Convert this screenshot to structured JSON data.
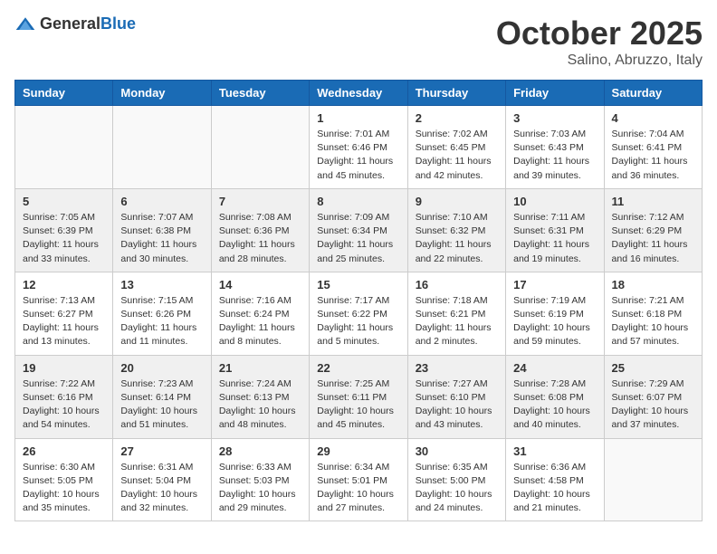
{
  "header": {
    "logo_general": "General",
    "logo_blue": "Blue",
    "month": "October 2025",
    "location": "Salino, Abruzzo, Italy"
  },
  "weekdays": [
    "Sunday",
    "Monday",
    "Tuesday",
    "Wednesday",
    "Thursday",
    "Friday",
    "Saturday"
  ],
  "weeks": [
    [
      {
        "day": "",
        "sunrise": "",
        "sunset": "",
        "daylight": ""
      },
      {
        "day": "",
        "sunrise": "",
        "sunset": "",
        "daylight": ""
      },
      {
        "day": "",
        "sunrise": "",
        "sunset": "",
        "daylight": ""
      },
      {
        "day": "1",
        "sunrise": "Sunrise: 7:01 AM",
        "sunset": "Sunset: 6:46 PM",
        "daylight": "Daylight: 11 hours and 45 minutes."
      },
      {
        "day": "2",
        "sunrise": "Sunrise: 7:02 AM",
        "sunset": "Sunset: 6:45 PM",
        "daylight": "Daylight: 11 hours and 42 minutes."
      },
      {
        "day": "3",
        "sunrise": "Sunrise: 7:03 AM",
        "sunset": "Sunset: 6:43 PM",
        "daylight": "Daylight: 11 hours and 39 minutes."
      },
      {
        "day": "4",
        "sunrise": "Sunrise: 7:04 AM",
        "sunset": "Sunset: 6:41 PM",
        "daylight": "Daylight: 11 hours and 36 minutes."
      }
    ],
    [
      {
        "day": "5",
        "sunrise": "Sunrise: 7:05 AM",
        "sunset": "Sunset: 6:39 PM",
        "daylight": "Daylight: 11 hours and 33 minutes."
      },
      {
        "day": "6",
        "sunrise": "Sunrise: 7:07 AM",
        "sunset": "Sunset: 6:38 PM",
        "daylight": "Daylight: 11 hours and 30 minutes."
      },
      {
        "day": "7",
        "sunrise": "Sunrise: 7:08 AM",
        "sunset": "Sunset: 6:36 PM",
        "daylight": "Daylight: 11 hours and 28 minutes."
      },
      {
        "day": "8",
        "sunrise": "Sunrise: 7:09 AM",
        "sunset": "Sunset: 6:34 PM",
        "daylight": "Daylight: 11 hours and 25 minutes."
      },
      {
        "day": "9",
        "sunrise": "Sunrise: 7:10 AM",
        "sunset": "Sunset: 6:32 PM",
        "daylight": "Daylight: 11 hours and 22 minutes."
      },
      {
        "day": "10",
        "sunrise": "Sunrise: 7:11 AM",
        "sunset": "Sunset: 6:31 PM",
        "daylight": "Daylight: 11 hours and 19 minutes."
      },
      {
        "day": "11",
        "sunrise": "Sunrise: 7:12 AM",
        "sunset": "Sunset: 6:29 PM",
        "daylight": "Daylight: 11 hours and 16 minutes."
      }
    ],
    [
      {
        "day": "12",
        "sunrise": "Sunrise: 7:13 AM",
        "sunset": "Sunset: 6:27 PM",
        "daylight": "Daylight: 11 hours and 13 minutes."
      },
      {
        "day": "13",
        "sunrise": "Sunrise: 7:15 AM",
        "sunset": "Sunset: 6:26 PM",
        "daylight": "Daylight: 11 hours and 11 minutes."
      },
      {
        "day": "14",
        "sunrise": "Sunrise: 7:16 AM",
        "sunset": "Sunset: 6:24 PM",
        "daylight": "Daylight: 11 hours and 8 minutes."
      },
      {
        "day": "15",
        "sunrise": "Sunrise: 7:17 AM",
        "sunset": "Sunset: 6:22 PM",
        "daylight": "Daylight: 11 hours and 5 minutes."
      },
      {
        "day": "16",
        "sunrise": "Sunrise: 7:18 AM",
        "sunset": "Sunset: 6:21 PM",
        "daylight": "Daylight: 11 hours and 2 minutes."
      },
      {
        "day": "17",
        "sunrise": "Sunrise: 7:19 AM",
        "sunset": "Sunset: 6:19 PM",
        "daylight": "Daylight: 10 hours and 59 minutes."
      },
      {
        "day": "18",
        "sunrise": "Sunrise: 7:21 AM",
        "sunset": "Sunset: 6:18 PM",
        "daylight": "Daylight: 10 hours and 57 minutes."
      }
    ],
    [
      {
        "day": "19",
        "sunrise": "Sunrise: 7:22 AM",
        "sunset": "Sunset: 6:16 PM",
        "daylight": "Daylight: 10 hours and 54 minutes."
      },
      {
        "day": "20",
        "sunrise": "Sunrise: 7:23 AM",
        "sunset": "Sunset: 6:14 PM",
        "daylight": "Daylight: 10 hours and 51 minutes."
      },
      {
        "day": "21",
        "sunrise": "Sunrise: 7:24 AM",
        "sunset": "Sunset: 6:13 PM",
        "daylight": "Daylight: 10 hours and 48 minutes."
      },
      {
        "day": "22",
        "sunrise": "Sunrise: 7:25 AM",
        "sunset": "Sunset: 6:11 PM",
        "daylight": "Daylight: 10 hours and 45 minutes."
      },
      {
        "day": "23",
        "sunrise": "Sunrise: 7:27 AM",
        "sunset": "Sunset: 6:10 PM",
        "daylight": "Daylight: 10 hours and 43 minutes."
      },
      {
        "day": "24",
        "sunrise": "Sunrise: 7:28 AM",
        "sunset": "Sunset: 6:08 PM",
        "daylight": "Daylight: 10 hours and 40 minutes."
      },
      {
        "day": "25",
        "sunrise": "Sunrise: 7:29 AM",
        "sunset": "Sunset: 6:07 PM",
        "daylight": "Daylight: 10 hours and 37 minutes."
      }
    ],
    [
      {
        "day": "26",
        "sunrise": "Sunrise: 6:30 AM",
        "sunset": "Sunset: 5:05 PM",
        "daylight": "Daylight: 10 hours and 35 minutes."
      },
      {
        "day": "27",
        "sunrise": "Sunrise: 6:31 AM",
        "sunset": "Sunset: 5:04 PM",
        "daylight": "Daylight: 10 hours and 32 minutes."
      },
      {
        "day": "28",
        "sunrise": "Sunrise: 6:33 AM",
        "sunset": "Sunset: 5:03 PM",
        "daylight": "Daylight: 10 hours and 29 minutes."
      },
      {
        "day": "29",
        "sunrise": "Sunrise: 6:34 AM",
        "sunset": "Sunset: 5:01 PM",
        "daylight": "Daylight: 10 hours and 27 minutes."
      },
      {
        "day": "30",
        "sunrise": "Sunrise: 6:35 AM",
        "sunset": "Sunset: 5:00 PM",
        "daylight": "Daylight: 10 hours and 24 minutes."
      },
      {
        "day": "31",
        "sunrise": "Sunrise: 6:36 AM",
        "sunset": "Sunset: 4:58 PM",
        "daylight": "Daylight: 10 hours and 21 minutes."
      },
      {
        "day": "",
        "sunrise": "",
        "sunset": "",
        "daylight": ""
      }
    ]
  ]
}
